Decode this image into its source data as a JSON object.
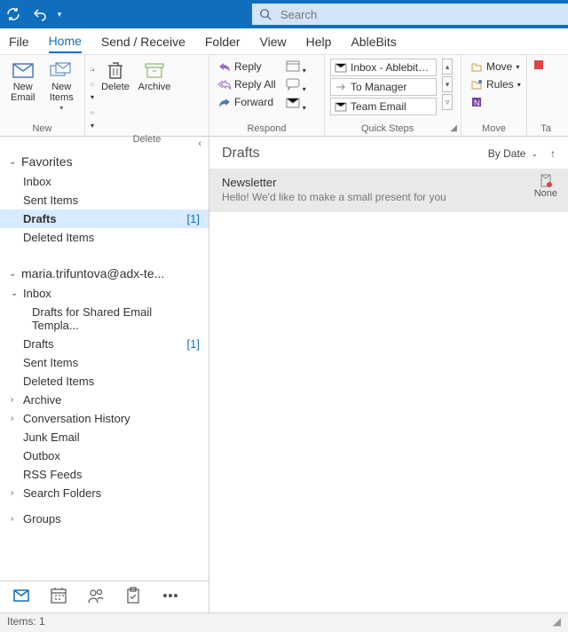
{
  "search": {
    "placeholder": "Search"
  },
  "menus": {
    "file": "File",
    "home": "Home",
    "sendreceive": "Send / Receive",
    "folder": "Folder",
    "view": "View",
    "help": "Help",
    "ablebits": "AbleBits"
  },
  "ribbon": {
    "new": {
      "label": "New",
      "new_email": "New\nEmail",
      "new_items": "New\nItems"
    },
    "delete": {
      "label": "Delete",
      "delete_btn": "Delete",
      "archive_btn": "Archive"
    },
    "respond": {
      "label": "Respond",
      "reply": "Reply",
      "reply_all": "Reply All",
      "forward": "Forward"
    },
    "quicksteps": {
      "label": "Quick Steps",
      "r1": "Inbox - Ablebits...",
      "r2": "To Manager",
      "r3": "Team Email"
    },
    "move": {
      "label": "Move",
      "move_btn": "Move",
      "rules_btn": "Rules"
    },
    "tags": {
      "label": "Ta"
    }
  },
  "nav": {
    "favorites": "Favorites",
    "fav": {
      "inbox": "Inbox",
      "sent": "Sent Items",
      "drafts": "Drafts",
      "drafts_count": "[1]",
      "deleted": "Deleted Items"
    },
    "account": "maria.trifuntova@adx-te...",
    "acc": {
      "inbox": "Inbox",
      "shared_drafts": "Drafts for Shared Email Templa...",
      "drafts": "Drafts",
      "drafts_count": "[1]",
      "sent": "Sent Items",
      "deleted": "Deleted Items",
      "archive": "Archive",
      "conv": "Conversation History",
      "junk": "Junk Email",
      "outbox": "Outbox",
      "rss": "RSS Feeds",
      "search_folders": "Search Folders",
      "groups": "Groups"
    }
  },
  "list": {
    "title": "Drafts",
    "sort": "By Date",
    "msg": {
      "subject": "Newsletter",
      "preview": "Hello!  We'd like to make a small present for you",
      "category": "None"
    }
  },
  "status": {
    "items": "Items: 1"
  }
}
